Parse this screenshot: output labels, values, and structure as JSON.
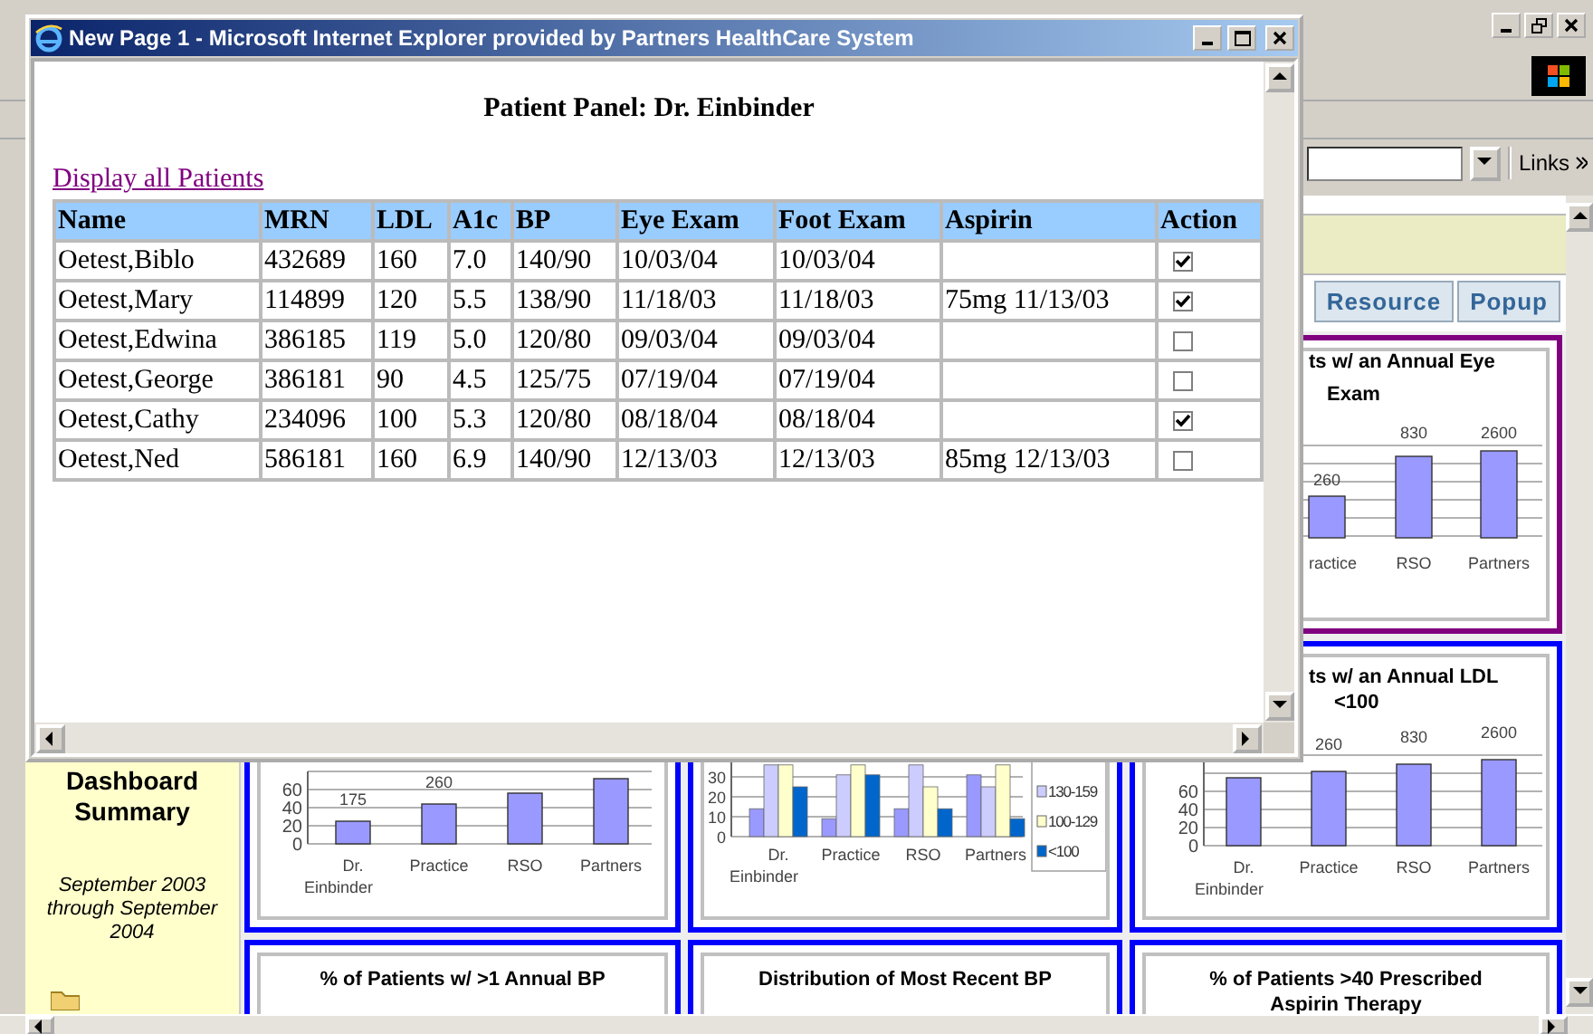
{
  "browser": {
    "links": "Links",
    "tabs": [
      {
        "label": "Resource",
        "selected": false
      },
      {
        "label": "Popup",
        "selected": false
      }
    ],
    "sidebar": {
      "title": "Dashboard Summary",
      "period": "September 2003 through September 2004"
    },
    "panels": [
      {
        "kind": "drawing",
        "selected": true,
        "title_lines": [
          "ts w/ an Annual Eye",
          "Exam"
        ],
        "bar_labels": [
          "260",
          "830",
          "2600"
        ],
        "categories": [
          "ractice",
          "RSO",
          "Partners"
        ]
      },
      {
        "kind": "bar",
        "selected": false,
        "chart_data": {
          "type": "bar",
          "categories": [
            "Dr. Einbinder",
            "Practice",
            "RSO",
            "Partners"
          ],
          "values": [
            25,
            44,
            56,
            72
          ],
          "ylim": [
            0,
            80
          ],
          "yticks": [
            0,
            20,
            40,
            60
          ],
          "grid": true,
          "annotations": [
            "175",
            "260",
            null,
            null
          ]
        }
      },
      {
        "kind": "grouped",
        "selected": false,
        "chart_data": {
          "type": "bar",
          "categories": [
            "Dr. Einbinder",
            "Practice",
            "RSO",
            "Partners"
          ],
          "ylim": [
            0,
            40
          ],
          "yticks": [
            0,
            10,
            20,
            30
          ],
          "grid": true,
          "legend": true,
          "series": [
            {
              "color": "#9999ff",
              "values": [
                14,
                9,
                14,
                31
              ]
            },
            {
              "name": "130-159",
              "color": "#ccccff",
              "values": [
                36,
                31,
                36,
                25
              ]
            },
            {
              "name": "100-129",
              "color": "#ffffcc",
              "values": [
                36,
                36,
                25,
                36
              ]
            },
            {
              "name": "<100",
              "color": "#0066cc",
              "values": [
                25,
                31,
                14,
                9
              ]
            }
          ]
        }
      },
      {
        "kind": "bar",
        "selected": false,
        "title_lines": [
          "ts w/ an Annual LDL",
          "<100"
        ],
        "chart_data": {
          "type": "bar",
          "categories": [
            "Dr. Einbinder",
            "Practice",
            "RSO",
            "Partners"
          ],
          "values": [
            75,
            82,
            90,
            95
          ],
          "ylim": [
            0,
            100
          ],
          "yticks": [
            0,
            20,
            40,
            60
          ],
          "grid": true,
          "annotations": [
            null,
            "260",
            "830",
            "2600"
          ]
        }
      },
      {
        "kind": "title",
        "selected": false,
        "title_lines": [
          "% of Patients w/ >1 Annual BP"
        ]
      },
      {
        "kind": "title",
        "selected": false,
        "title_lines": [
          "Distribution of Most Recent BP"
        ]
      },
      {
        "kind": "title",
        "selected": false,
        "title_lines": [
          "% of Patients >40 Prescribed",
          "Aspirin Therapy"
        ]
      }
    ]
  },
  "popup": {
    "title": "New Page 1 - Microsoft Internet Explorer provided by Partners HealthCare System",
    "heading": "Patient Panel: Dr. Einbinder",
    "link": "Display all Patients",
    "columns": [
      "Name",
      "MRN",
      "LDL",
      "A1c",
      "BP",
      "Eye Exam",
      "Foot Exam",
      "Aspirin",
      "Action"
    ],
    "rows": [
      {
        "name": "Oetest,Biblo",
        "mrn": "432689",
        "ldl": "160",
        "a1c": "7.0",
        "bp": "140/90",
        "eye_exam": "10/03/04",
        "foot_exam": "10/03/04",
        "action": true
      },
      {
        "name": "Oetest,Mary",
        "mrn": "114899",
        "ldl": "120",
        "a1c": "5.5",
        "bp": "138/90",
        "eye_exam": "11/18/03",
        "foot_exam": "11/18/03",
        "aspirin": "75mg 11/13/03",
        "action": true
      },
      {
        "name": "Oetest,Edwina",
        "mrn": "386185",
        "ldl": "119",
        "a1c": "5.0",
        "bp": "120/80",
        "eye_exam": "09/03/04",
        "foot_exam": "09/03/04",
        "action": false
      },
      {
        "name": "Oetest,George",
        "mrn": "386181",
        "ldl": "90",
        "a1c": "4.5",
        "bp": "125/75",
        "eye_exam": "07/19/04",
        "foot_exam": "07/19/04",
        "action": false
      },
      {
        "name": "Oetest,Cathy",
        "mrn": "234096",
        "ldl": "100",
        "a1c": "5.3",
        "bp": "120/80",
        "eye_exam": "08/18/04",
        "foot_exam": "08/18/04",
        "action": true
      },
      {
        "name": "Oetest,Ned",
        "mrn": "586181",
        "ldl": "160",
        "a1c": "6.9",
        "bp": "140/90",
        "eye_exam": "12/13/03",
        "foot_exam": "12/13/03",
        "aspirin": "85mg 12/13/03",
        "action": false
      }
    ]
  }
}
